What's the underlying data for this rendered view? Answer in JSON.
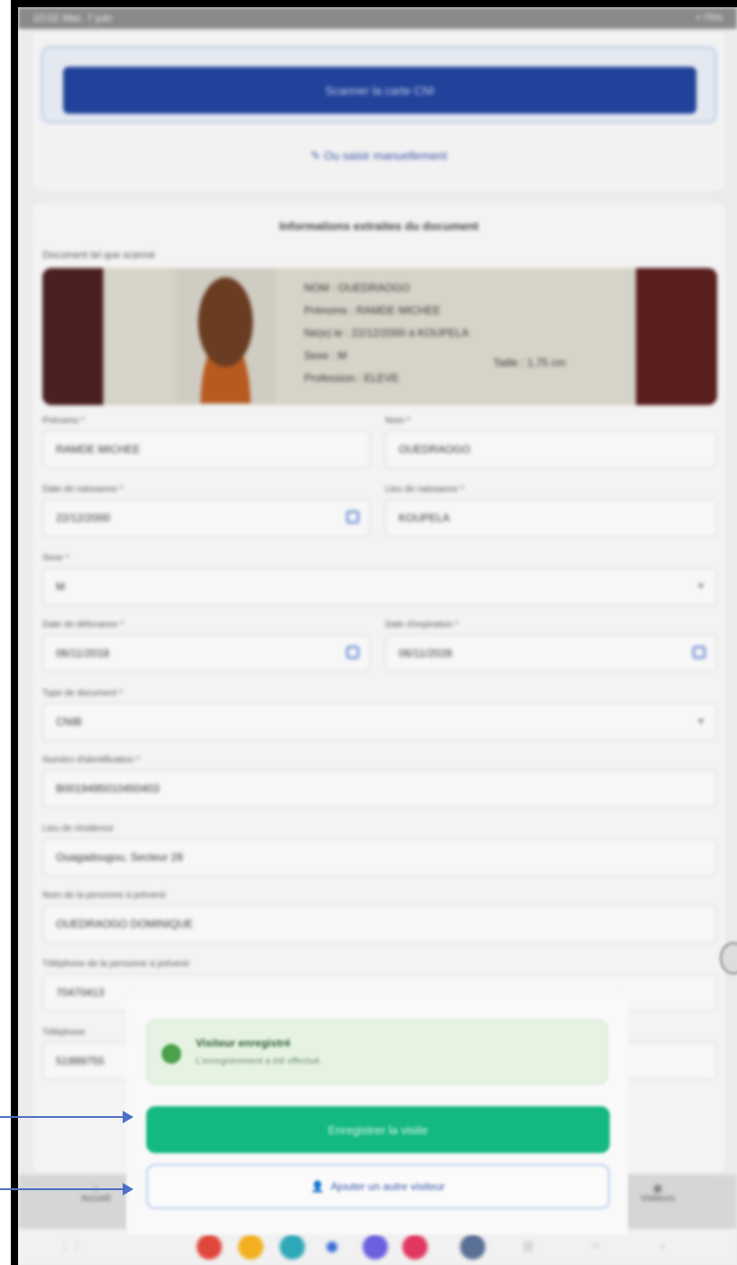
{
  "status_bar": {
    "left": "10:02  Mer. 7 juin",
    "right": "• 75%"
  },
  "scan": {
    "button_label": "Scanner la carte CNI",
    "manual_label": "Ou saisir manuellement"
  },
  "info": {
    "title": "Informations extraites du document",
    "doc_label": "Document tel que scanné",
    "id_card": {
      "nom_line": "NOM : OUEDRAOGO",
      "prenoms_line": "Prénoms : RAMDE MICHEE",
      "naissance_line": "Né(e) le : 22/12/2000  à  KOUPELA",
      "sexe_line": "Sexe : M",
      "profession_line": "Profession : ELEVE",
      "taille": "Taille : 1,75 cm"
    }
  },
  "form": {
    "prenoms": {
      "label": "Prénoms *",
      "value": "RAMDE MICHEE"
    },
    "nom": {
      "label": "Nom *",
      "value": "OUEDRAOGO"
    },
    "date_naissance": {
      "label": "Date de naissance *",
      "value": "22/12/2000"
    },
    "lieu_naissance": {
      "label": "Lieu de naissance *",
      "value": "KOUPELA"
    },
    "sexe": {
      "label": "Sexe *",
      "value": "M"
    },
    "date_delivrance": {
      "label": "Date de délivrance *",
      "value": "06/11/2018"
    },
    "date_expiration": {
      "label": "Date d'expiration *",
      "value": "06/11/2028"
    },
    "type_document": {
      "label": "Type de document *",
      "value": "CNIB"
    },
    "numero_identification": {
      "label": "Numéro d'identification *",
      "value": "B0019495010450403"
    },
    "lieu_residence": {
      "label": "Lieu de résidence",
      "value": "Ouagadougou, Secteur 28"
    },
    "personne_prevenir": {
      "label": "Nom de la personne à prévenir",
      "value": "OUEDRAOGO DOMINIQUE"
    },
    "telephone_prevenir": {
      "label": "Téléphone de la personne à prévenir",
      "value": "70470413"
    },
    "telephone": {
      "label": "Téléphone",
      "value": "51999755"
    }
  },
  "nav": {
    "left": "Accueil",
    "right": "Visiteurs"
  },
  "modal": {
    "success_title": "Visiteur enregistré",
    "success_sub": "L'enregistrement a été effectué.",
    "save_button": "Enregistrer la visite",
    "add_button": "Ajouter un autre visiteur"
  },
  "colors": {
    "primary": "#21429a",
    "success": "#14b881",
    "accent": "#3b58a8",
    "annotation_arrow": "#4e6fc6"
  },
  "icons": [
    "pencil-icon",
    "calendar-icon",
    "chevron-down-icon",
    "check-icon",
    "user-add-icon",
    "home-icon",
    "visitors-icon",
    "app-icons"
  ]
}
